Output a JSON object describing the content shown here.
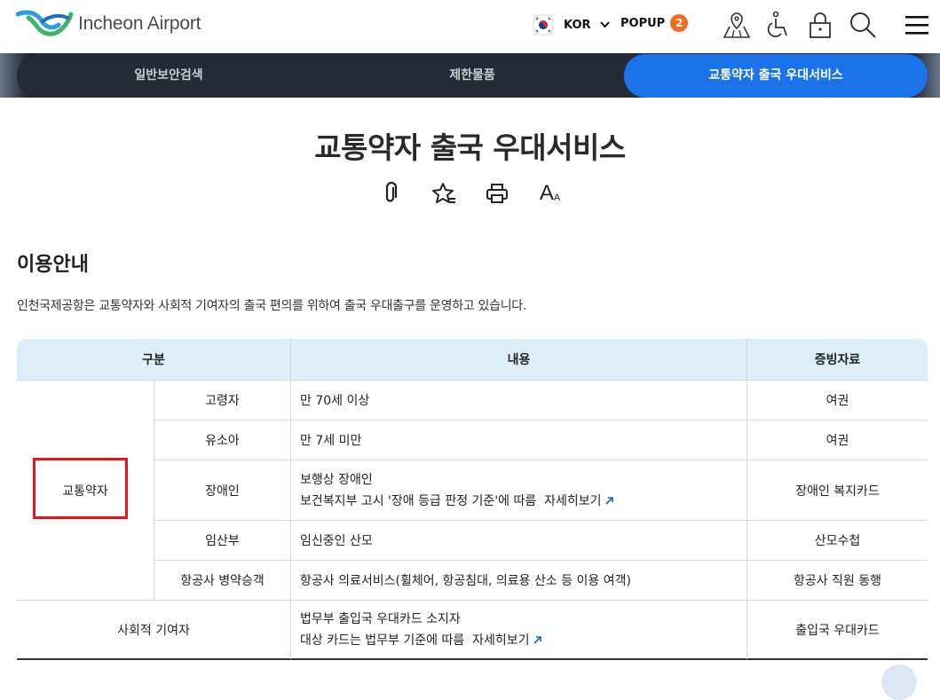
{
  "header": {
    "logo_text": "Incheon Airport",
    "language": "KOR",
    "popup_label": "POPUP",
    "popup_count": "2"
  },
  "tabs": [
    {
      "label": "일반보안검색",
      "active": false
    },
    {
      "label": "제한물품",
      "active": false
    },
    {
      "label": "교통약자 출국 우대서비스",
      "active": true
    }
  ],
  "page": {
    "title": "교통약자 출국 우대서비스",
    "tools": [
      "clip-icon",
      "favorite-star-icon",
      "print-icon",
      "font-size-icon"
    ],
    "font_tool_label": "A"
  },
  "section": {
    "title": "이용안내",
    "intro": "인천국제공항은 교통약자와 사회적 기여자의 출국 편의를 위하여 출국 우대출구를 운영하고 있습니다."
  },
  "table": {
    "headers": [
      "구분",
      "내용",
      "증빙자료"
    ],
    "group_weak": "교통약자",
    "rows": [
      {
        "category": "고령자",
        "content": "만 70세 이상",
        "proof": "여권"
      },
      {
        "category": "유소아",
        "content": "만 7세 미만",
        "proof": "여권"
      },
      {
        "category": "장애인",
        "content_line1": "보행상 장애인",
        "content_line2": "보건복지부 고시 '장애 등급 판정 기준'에 따름",
        "link": "자세히보기",
        "proof": "장애인 복지카드"
      },
      {
        "category": "임산부",
        "content": "임신중인 산모",
        "proof": "산모수첩"
      },
      {
        "category": "항공사 병약승객",
        "content": "항공사 의료서비스(휠체어, 항공침대, 의료용 산소 등 이용 여객)",
        "proof": "항공사 직원 동행"
      }
    ],
    "contributor": {
      "category": "사회적 기여자",
      "content_line1": "법무부 출입국 우대카드 소지자",
      "content_line2": "대상 카드는 법무부 기준에 따름",
      "link": "자세히보기",
      "proof": "출입국 우대카드"
    }
  },
  "colors": {
    "active_tab": "#1a73e8",
    "tab_bar": "#222b36",
    "table_header": "#ddeef9",
    "badge": "#f26c1f",
    "highlight": "#e8141c"
  }
}
